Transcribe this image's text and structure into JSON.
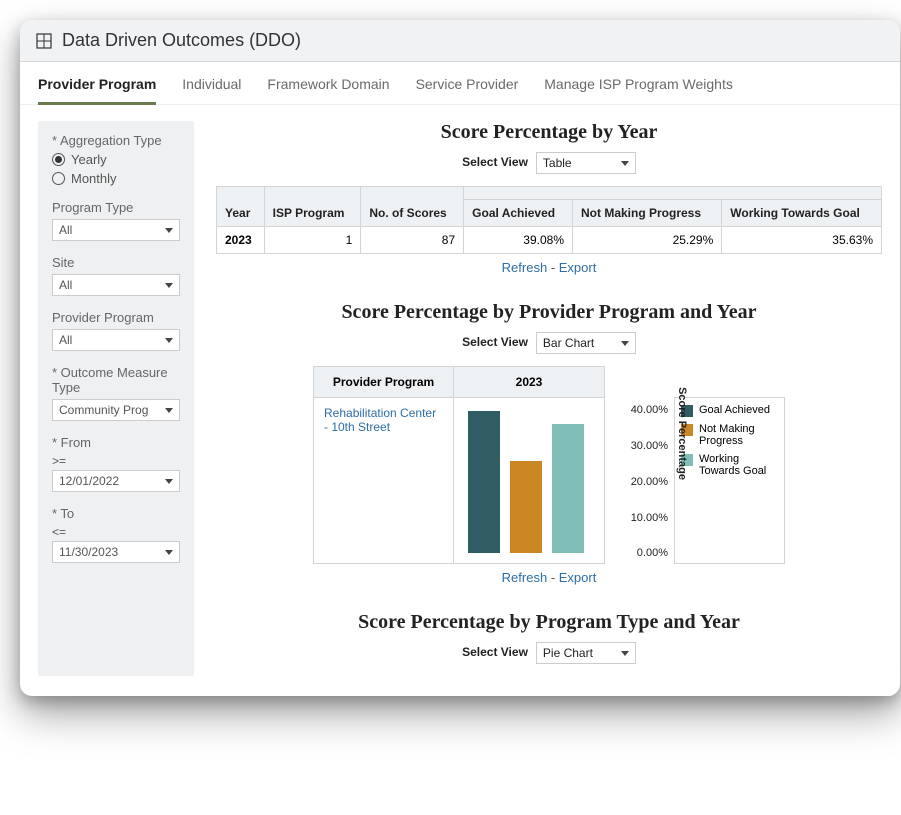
{
  "title": "Data Driven Outcomes (DDO)",
  "tabs": [
    "Provider Program",
    "Individual",
    "Framework Domain",
    "Service Provider",
    "Manage ISP Program Weights"
  ],
  "sidebar": {
    "aggregation_label": "* Aggregation Type",
    "agg_options": {
      "yearly": "Yearly",
      "monthly": "Monthly"
    },
    "program_type_label": "Program Type",
    "program_type_value": "All",
    "site_label": "Site",
    "site_value": "All",
    "provider_program_label": "Provider Program",
    "provider_program_value": "All",
    "outcome_label": "* Outcome Measure Type",
    "outcome_value": "Community Prog",
    "from_label": "* From",
    "from_op": ">=",
    "from_value": "12/01/2022",
    "to_label": "* To",
    "to_op": "<=",
    "to_value": "11/30/2023"
  },
  "section1": {
    "title": "Score Percentage by Year",
    "view_label": "Select View",
    "view_value": "Table",
    "headers": {
      "year": "Year",
      "isp": "ISP Program",
      "scores": "No. of Scores",
      "ga": "Goal Achieved",
      "nmp": "Not Making Progress",
      "wtg": "Working Towards Goal"
    },
    "row": {
      "year": "2023",
      "isp": "1",
      "scores": "87",
      "ga": "39.08%",
      "nmp": "25.29%",
      "wtg": "35.63%"
    },
    "refresh": "Refresh",
    "export": "Export"
  },
  "section2": {
    "title": "Score Percentage by Provider Program and Year",
    "view_label": "Select View",
    "view_value": "Bar Chart",
    "headers": {
      "provider": "Provider Program",
      "year": "2023"
    },
    "provider": "Rehabilitation Center - 10th Street",
    "axis_title": "Score Percentage",
    "legend": {
      "ga": "Goal Achieved",
      "nmp": "Not Making Progress",
      "wtg": "Working Towards Goal"
    },
    "ticks": [
      "40.00%",
      "30.00%",
      "20.00%",
      "10.00%",
      "0.00%"
    ],
    "refresh": "Refresh",
    "export": "Export"
  },
  "section3": {
    "title": "Score Percentage by Program Type and Year",
    "view_label": "Select View",
    "view_value": "Pie Chart"
  },
  "chart_data": {
    "type": "bar",
    "categories": [
      "Goal Achieved",
      "Not Making Progress",
      "Working Towards Goal"
    ],
    "values": [
      39.08,
      25.29,
      35.63
    ],
    "title": "Score Percentage by Provider Program and Year — 2023",
    "ylabel": "Score Percentage",
    "ylim": [
      0,
      40
    ],
    "colors": [
      "#2f5d63",
      "#cc8725",
      "#7fbfb8"
    ],
    "series_name": "Rehabilitation Center - 10th Street"
  }
}
